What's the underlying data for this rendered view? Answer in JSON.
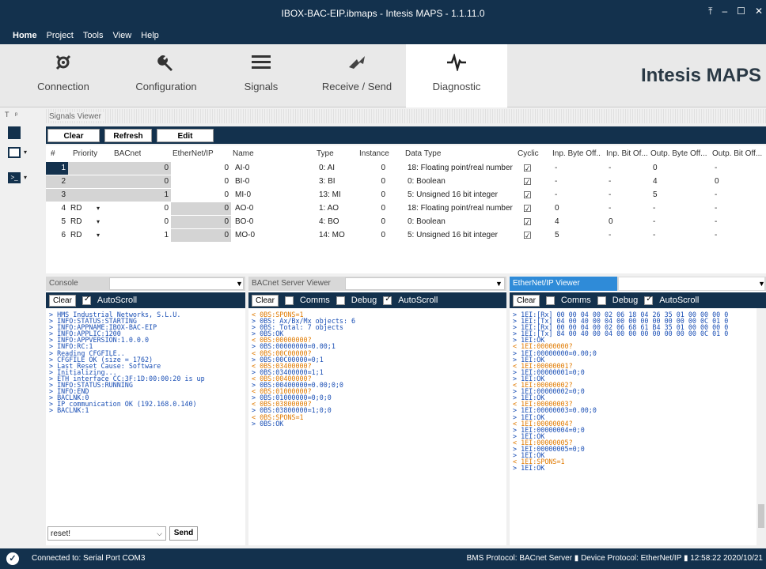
{
  "window": {
    "title": "IBOX-BAC-EIP.ibmaps - Intesis MAPS - 1.1.11.0",
    "controls": [
      "⤒",
      "–",
      "☐",
      "✕"
    ]
  },
  "menu": [
    "Home",
    "Project",
    "Tools",
    "View",
    "Help"
  ],
  "ribbon": {
    "tabs": [
      {
        "label": "Connection",
        "icon": "connection-icon"
      },
      {
        "label": "Configuration",
        "icon": "wrench-icon"
      },
      {
        "label": "Signals",
        "icon": "list-icon"
      },
      {
        "label": "Receive / Send",
        "icon": "transfer-icon"
      },
      {
        "label": "Diagnostic",
        "icon": "pulse-icon",
        "selected": true
      }
    ],
    "brand": "Intesis MAPS"
  },
  "signals_viewer": {
    "title": "Signals Viewer",
    "buttons": {
      "clear": "Clear",
      "refresh": "Refresh",
      "edit_columns": "Edit columns"
    },
    "columns": [
      "#",
      "Priority",
      "BACnet",
      "EtherNet/IP",
      "Name",
      "Type",
      "Instance",
      "Data Type",
      "Cyclic",
      "Inp. Byte Off...",
      "Inp. Bit Of...",
      "Outp. Byte Off...",
      "Outp. Bit Off..."
    ],
    "rows": [
      {
        "n": "1",
        "pri": "",
        "bac": "0",
        "eip": "0",
        "name": "AI-0",
        "type": "0: AI",
        "inst": "0",
        "dt": "18: Floating point/real number",
        "cyc": true,
        "ibyo": "-",
        "ibio": "-",
        "obyo": "0",
        "obio": "-"
      },
      {
        "n": "2",
        "pri": "",
        "bac": "0",
        "eip": "0",
        "name": "BI-0",
        "type": "3: BI",
        "inst": "0",
        "dt": "0: Boolean",
        "cyc": true,
        "ibyo": "-",
        "ibio": "-",
        "obyo": "4",
        "obio": "0"
      },
      {
        "n": "3",
        "pri": "",
        "bac": "1",
        "eip": "0",
        "name": "MI-0",
        "type": "13: MI",
        "inst": "0",
        "dt": "5: Unsigned 16 bit integer",
        "cyc": true,
        "ibyo": "-",
        "ibio": "-",
        "obyo": "5",
        "obio": "-"
      },
      {
        "n": "4",
        "pri": "RD",
        "bac": "0",
        "eip": "0",
        "name": "AO-0",
        "type": "1: AO",
        "inst": "0",
        "dt": "18: Floating point/real number",
        "cyc": true,
        "ibyo": "0",
        "ibio": "-",
        "obyo": "-",
        "obio": "-"
      },
      {
        "n": "5",
        "pri": "RD",
        "bac": "0",
        "eip": "0",
        "name": "BO-0",
        "type": "4: BO",
        "inst": "0",
        "dt": "0: Boolean",
        "cyc": true,
        "ibyo": "4",
        "ibio": "0",
        "obyo": "-",
        "obio": "-"
      },
      {
        "n": "6",
        "pri": "RD",
        "bac": "1",
        "eip": "0",
        "name": "MO-0",
        "type": "14: MO",
        "inst": "0",
        "dt": "5: Unsigned 16 bit integer",
        "cyc": true,
        "ibyo": "5",
        "ibio": "-",
        "obyo": "-",
        "obio": "-"
      }
    ]
  },
  "console": {
    "title": "Console",
    "clear": "Clear",
    "autoscroll": "AutoScroll",
    "input_value": "reset!",
    "send": "Send",
    "lines": [
      "> HMS Industrial Networks, S.L.U.",
      "> INFO:STATUS:STARTING",
      "> INFO:APPNAME:IBOX-BAC-EIP",
      "> INFO:APPLIC:1200",
      "> INFO:APPVERSION:1.0.0.0",
      "> INFO:RC:1",
      "> Reading CFGFILE..",
      "> CFGFILE OK (size = 1762)",
      "> Last Reset Cause: Software",
      "> Initializing...",
      "> ETH interface CC:3F:1D:00:00:20 is up",
      "> INFO:STATUS:RUNNING",
      "> INFO:END",
      "> BACLNK:0",
      "> IP communication OK (192.168.0.140)",
      "> BACLNK:1"
    ]
  },
  "bacnet_viewer": {
    "title": "BACnet Server Viewer",
    "clear": "Clear",
    "comms": "Comms",
    "debug": "Debug",
    "autoscroll": "AutoScroll",
    "lines": [
      "< 0BS:SPONS=1",
      "> 0BS: Ax/Bx/Mx objects: 6",
      "> 0BS: Total: 7 objects",
      "> 0BS:OK",
      "< 0BS:00000000?",
      "> 0BS:00000000=0.00;1",
      "< 0BS:00C00000?",
      "> 0BS:00C00000=0;1",
      "< 0BS:03400000?",
      "> 0BS:03400000=1;1",
      "< 0BS:00400000?",
      "> 0BS:00400000=0.00;0;0",
      "< 0BS:01000000?",
      "> 0BS:01000000=0;0;0",
      "< 0BS:03800000?",
      "> 0BS:03800000=1;0;0",
      "< 0BS:SPONS=1",
      "> 0BS:OK"
    ]
  },
  "eip_viewer": {
    "title": "EtherNet/IP Viewer",
    "clear": "Clear",
    "comms": "Comms",
    "debug": "Debug",
    "autoscroll": "AutoScroll",
    "lines": [
      "> 1EI:[Rx] 00 00 04 00 02 06 18 04 26 35 01 00 00 00 0",
      "> 1EI:[Tx] 04 00 40 00 04 00 00 00 00 00 00 00 0C 01 0",
      "> 1EI:[Rx] 00 00 04 00 02 06 68 61 B4 35 01 00 00 00 0",
      "> 1EI:[Tx] 84 00 40 00 04 00 00 00 00 00 00 00 0C 01 0",
      "> 1EI:OK",
      "< 1EI:00000000?",
      "> 1EI:00000000=0.00;0",
      "> 1EI:OK",
      "< 1EI:00000001?",
      "> 1EI:00000001=0;0",
      "> 1EI:OK",
      "< 1EI:00000002?",
      "> 1EI:00000002=0;0",
      "> 1EI:OK",
      "< 1EI:00000003?",
      "> 1EI:00000003=0.00;0",
      "> 1EI:OK",
      "< 1EI:00000004?",
      "> 1EI:00000004=0;0",
      "> 1EI:OK",
      "< 1EI:00000005?",
      "> 1EI:00000005=0;0",
      "> 1EI:OK",
      "< 1EI:SPONS=1",
      "> 1EI:OK"
    ]
  },
  "status": {
    "left": "Connected to: Serial Port COM3",
    "right": "BMS Protocol: BACnet Server  ▮  Device Protocol: EtherNet/IP  ▮  12:58:22 2020/10/21"
  },
  "colors": {
    "dark": "#13314d",
    "out": "#e07a00",
    "in": "#1a4fb5"
  }
}
